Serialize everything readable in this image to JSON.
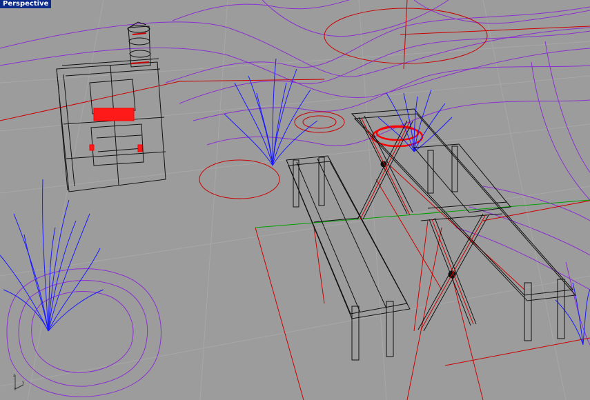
{
  "viewport": {
    "title": "Perspective",
    "colors": {
      "background": "#9c9c9c",
      "grid": "#a6a6a6",
      "contour": "#8a2fd0",
      "grass": "#1a1aff",
      "selected": "#ff0000",
      "x_axis": "#cc0000",
      "y_axis": "#00a000",
      "wire": "#111111"
    },
    "icons": {
      "axis_widget": "world-axes-icon"
    }
  }
}
